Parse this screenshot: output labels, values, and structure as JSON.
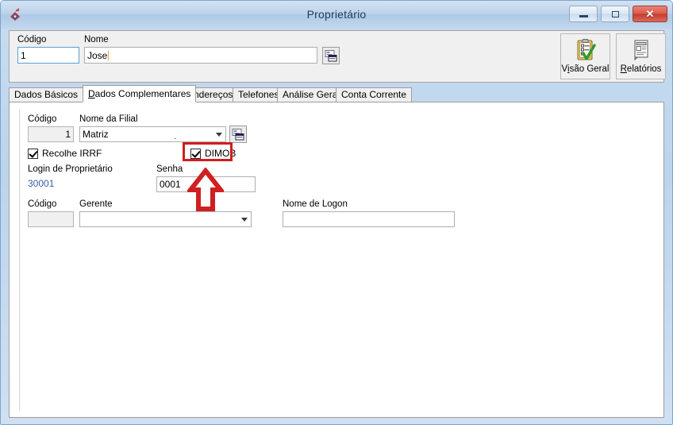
{
  "window": {
    "title": "Proprietário",
    "app_icon": "diamond-app-icon",
    "buttons": {
      "minimize": "minimize-icon",
      "maximize": "maximize-icon",
      "close": "✕"
    }
  },
  "header": {
    "codigo_label": "Código",
    "codigo_value": "1",
    "nome_label": "Nome",
    "nome_value": "Jose",
    "picker_icon": "form-picker-icon",
    "tools": [
      {
        "label_prefix": "V",
        "label_accesskey": "i",
        "label_suffix": "são Geral",
        "name": "visao-geral",
        "icon": "clipboard-check-icon"
      },
      {
        "label_prefix": "",
        "label_accesskey": "R",
        "label_suffix": "elatórios",
        "name": "relatorios",
        "icon": "report-document-icon"
      }
    ]
  },
  "tabs": [
    {
      "label": "Dados Básicos",
      "active": false
    },
    {
      "label": "Dados Complementares",
      "active": true,
      "accesskey": "D"
    },
    {
      "label": "Endereços",
      "active": false
    },
    {
      "label": "Telefones",
      "active": false
    },
    {
      "label": "Análise Geral",
      "active": false
    },
    {
      "label": "Conta Corrente",
      "active": false
    }
  ],
  "form": {
    "filial_codigo_label": "Código",
    "filial_codigo_value": "1",
    "filial_nome_label": "Nome da Filial",
    "filial_nome_value": "Matriz",
    "filial_nome_trail": ".",
    "filial_picker_icon": "form-picker-icon",
    "recolhe_irrf_label": "Recolhe IRRF",
    "recolhe_irrf_checked": true,
    "dimob_label": "DIMOB",
    "dimob_checked": true,
    "login_label": "Login de Proprietário",
    "login_value": "30001",
    "senha_label": "Senha",
    "senha_value": "0001",
    "gerente_codigo_label": "Código",
    "gerente_codigo_value": "",
    "gerente_label": "Gerente",
    "gerente_value": "",
    "logon_label": "Nome de Logon",
    "logon_value": ""
  },
  "annotation": {
    "highlight_target": "dimob-checkbox",
    "arrow_direction": "up",
    "color": "#d01f20"
  }
}
